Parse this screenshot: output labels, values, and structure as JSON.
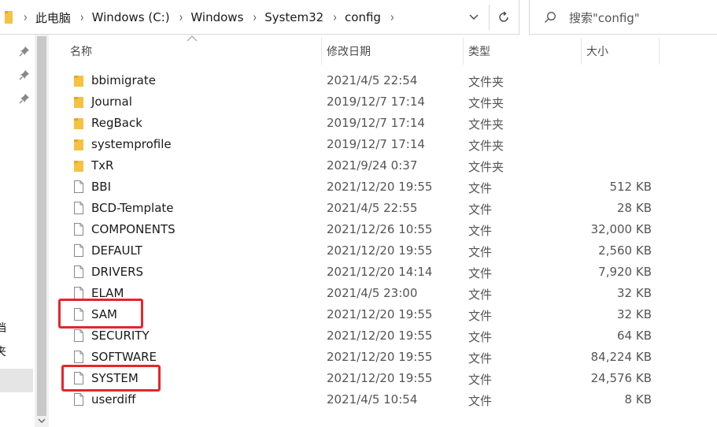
{
  "address_bar": {
    "crumbs": [
      "此电脑",
      "Windows (C:)",
      "Windows",
      "System32",
      "config"
    ]
  },
  "search": {
    "placeholder": "搜索\"config\""
  },
  "nav": {
    "texts": [
      "档",
      "夹"
    ]
  },
  "columns": {
    "name": "名称",
    "date": "修改日期",
    "type": "类型",
    "size": "大小"
  },
  "files": [
    {
      "name": "bbimigrate",
      "date": "2021/4/5 22:54",
      "type": "文件夹",
      "size": "",
      "icon": "folder-icon"
    },
    {
      "name": "Journal",
      "date": "2019/12/7 17:14",
      "type": "文件夹",
      "size": "",
      "icon": "folder-icon"
    },
    {
      "name": "RegBack",
      "date": "2019/12/7 17:14",
      "type": "文件夹",
      "size": "",
      "icon": "folder-icon"
    },
    {
      "name": "systemprofile",
      "date": "2019/12/7 17:14",
      "type": "文件夹",
      "size": "",
      "icon": "folder-icon"
    },
    {
      "name": "TxR",
      "date": "2021/9/24 0:37",
      "type": "文件夹",
      "size": "",
      "icon": "folder-icon"
    },
    {
      "name": "BBI",
      "date": "2021/12/20 19:55",
      "type": "文件",
      "size": "512 KB",
      "icon": "file-icon"
    },
    {
      "name": "BCD-Template",
      "date": "2021/4/5 22:55",
      "type": "文件",
      "size": "28 KB",
      "icon": "file-icon"
    },
    {
      "name": "COMPONENTS",
      "date": "2021/12/26 10:55",
      "type": "文件",
      "size": "32,000 KB",
      "icon": "file-icon"
    },
    {
      "name": "DEFAULT",
      "date": "2021/12/20 19:55",
      "type": "文件",
      "size": "2,560 KB",
      "icon": "file-icon"
    },
    {
      "name": "DRIVERS",
      "date": "2021/12/20 14:14",
      "type": "文件",
      "size": "7,920 KB",
      "icon": "file-icon"
    },
    {
      "name": "ELAM",
      "date": "2021/4/5 23:00",
      "type": "文件",
      "size": "32 KB",
      "icon": "file-icon"
    },
    {
      "name": "SAM",
      "date": "2021/12/20 19:55",
      "type": "文件",
      "size": "32 KB",
      "icon": "file-icon"
    },
    {
      "name": "SECURITY",
      "date": "2021/12/20 19:55",
      "type": "文件",
      "size": "64 KB",
      "icon": "file-icon"
    },
    {
      "name": "SOFTWARE",
      "date": "2021/12/20 19:55",
      "type": "文件",
      "size": "84,224 KB",
      "icon": "file-icon"
    },
    {
      "name": "SYSTEM",
      "date": "2021/12/20 19:55",
      "type": "文件",
      "size": "24,576 KB",
      "icon": "file-icon"
    },
    {
      "name": "userdiff",
      "date": "2021/4/5 10:54",
      "type": "文件",
      "size": "8 KB",
      "icon": "file-icon"
    }
  ],
  "highlighted_files": [
    "SAM",
    "SYSTEM"
  ],
  "colors": {
    "folder": "#f5c242",
    "highlight": "#e5262b",
    "selected_nav": "#e5e5e5"
  }
}
